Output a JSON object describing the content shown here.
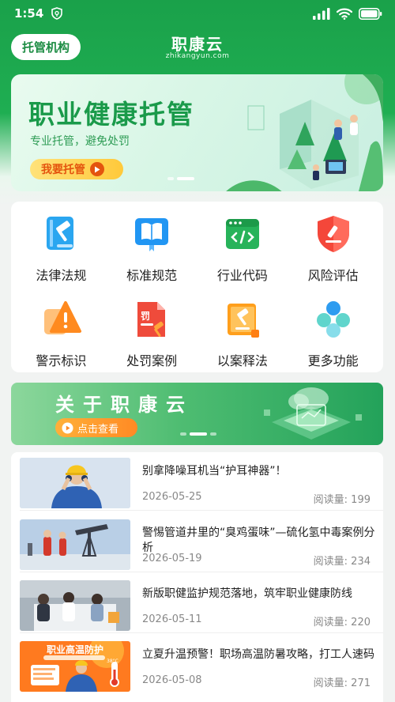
{
  "status_bar": {
    "time": "1:54",
    "icons": [
      "shield-icon",
      "signal-icon",
      "wifi-icon",
      "battery-icon"
    ]
  },
  "header": {
    "org_button": "托管机构",
    "title": "职康云",
    "domain": "zhikangyun.com"
  },
  "banner": {
    "title": "职业健康托管",
    "subtitle": "专业托管，避免处罚",
    "button": "我要托管",
    "slide_count": 2,
    "active_slide": 2
  },
  "features": [
    {
      "label": "法律法规",
      "icon": "law-book-icon",
      "color": "#2aa6f0"
    },
    {
      "label": "标准规范",
      "icon": "standard-book-icon",
      "color": "#2196f3"
    },
    {
      "label": "行业代码",
      "icon": "code-window-icon",
      "color": "#27b35a"
    },
    {
      "label": "风险评估",
      "icon": "risk-shield-icon",
      "color": "#f4473a"
    },
    {
      "label": "警示标识",
      "icon": "warning-sign-icon",
      "color": "#ff8a1f"
    },
    {
      "label": "处罚案例",
      "icon": "penalty-document-icon",
      "color": "#ef4b3b"
    },
    {
      "label": "以案释法",
      "icon": "gavel-book-icon",
      "color": "#ff9f1c"
    },
    {
      "label": "更多功能",
      "icon": "more-features-icon",
      "color": "#35b6ea"
    }
  ],
  "about": {
    "title": "关于职康云",
    "button": "点击查看",
    "slide_count": 3,
    "active_slide": 2
  },
  "news": [
    {
      "title": "别拿降噪耳机当“护耳神器”！",
      "date": "2026-05-25",
      "views_label": "阅读量:",
      "views": "199"
    },
    {
      "title": "警惕管道井里的“臭鸡蛋味”—硫化氢中毒案例分析",
      "date": "2026-05-19",
      "views_label": "阅读量:",
      "views": "234"
    },
    {
      "title": "新版职健监护规范落地，筑牢职业健康防线",
      "date": "2026-05-11",
      "views_label": "阅读量:",
      "views": "220"
    },
    {
      "title": "立夏升温预警！职场高温防暑攻略，打工人速码",
      "date": "2026-05-08",
      "views_label": "阅读量:",
      "views": "271"
    }
  ],
  "news_thumb_text": {
    "heat_title": "职业高温防护",
    "temperature": "38°C"
  },
  "colors": {
    "brand_green": "#1aa14a",
    "accent_orange": "#e4540e"
  }
}
